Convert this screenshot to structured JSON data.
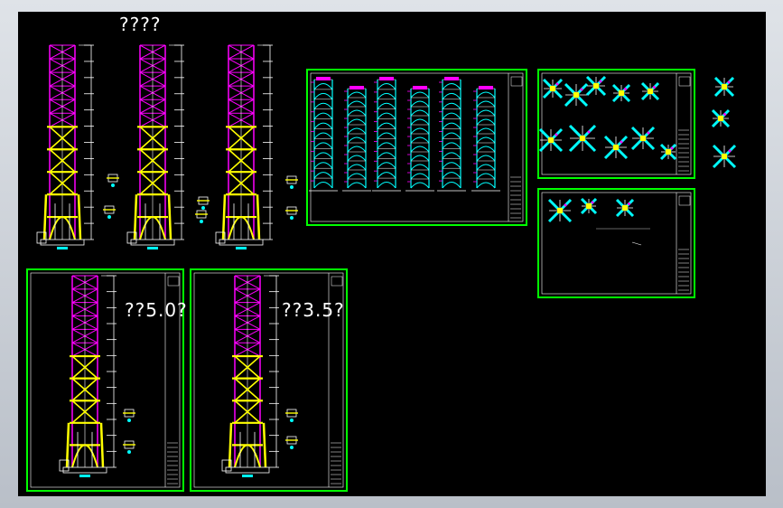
{
  "labels": {
    "main_title": "????",
    "left_panel_title": "??5.0?",
    "right_panel_title": "??3.5?"
  },
  "colors": {
    "background": "#000000",
    "frame_border": "#00ff00",
    "magenta": "#ff00ff",
    "yellow": "#ffff00",
    "white": "#ffffff",
    "cyan": "#00ffff"
  }
}
